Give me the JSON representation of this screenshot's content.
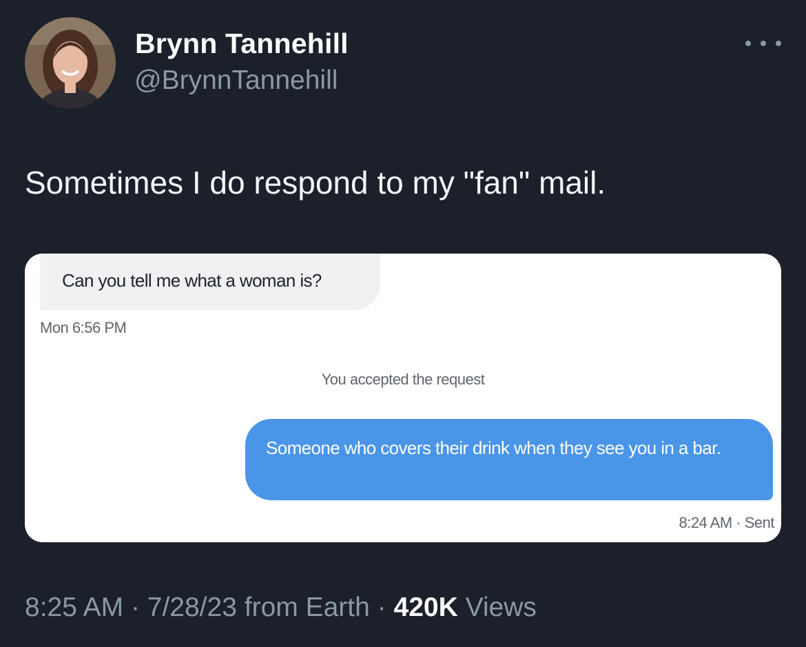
{
  "author": {
    "display_name": "Brynn Tannehill",
    "handle": "@BrynnTannehill",
    "avatar_icon": "profile-photo"
  },
  "more_icon": "ellipsis-icon",
  "tweet": {
    "text": "Sometimes I do respond to my \"fan\" mail."
  },
  "media": {
    "incoming_message": "Can you tell me what a woman is?",
    "incoming_timestamp": "Mon 6:56 PM",
    "system_notice": "You accepted the request",
    "outgoing_message": "Someone who covers their drink when they see you in a bar.",
    "outgoing_timestamp": "8:24 AM · Sent",
    "colors": {
      "incoming_bubble": "#eff1f3",
      "outgoing_bubble": "#4b95e8"
    }
  },
  "meta": {
    "time": "8:25 AM",
    "separator": "·",
    "date": "7/28/23",
    "source": "from Earth",
    "views_count": "420K",
    "views_label": "Views"
  },
  "colors": {
    "background": "#1b202b",
    "secondary_text": "#8b98a5",
    "primary_text": "#ffffff"
  }
}
